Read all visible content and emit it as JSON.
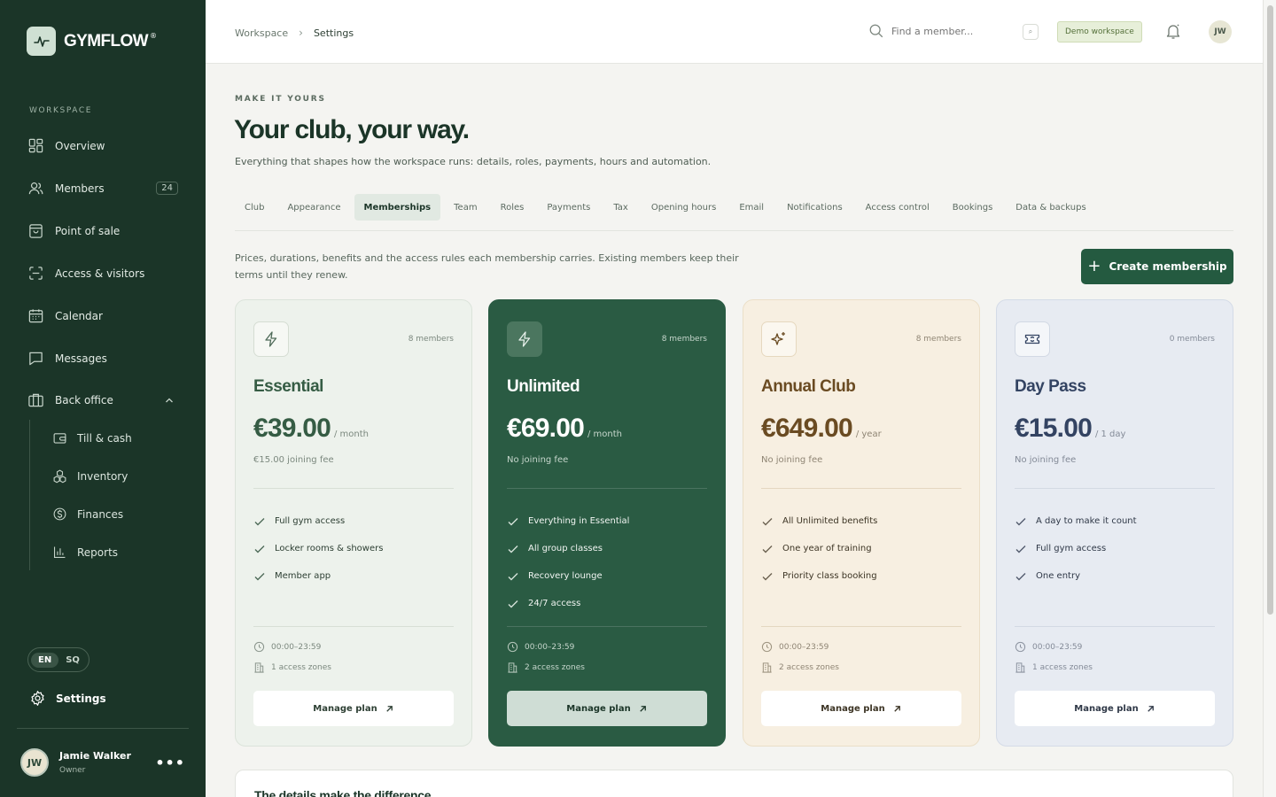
{
  "brand": {
    "name": "GYMFLOW",
    "reg": "®"
  },
  "sidebar": {
    "section_label": "WORKSPACE",
    "items": [
      {
        "label": "Overview",
        "icon": "grid-icon"
      },
      {
        "label": "Members",
        "icon": "users-icon",
        "badge": "24"
      },
      {
        "label": "Point of sale",
        "icon": "bag-icon"
      },
      {
        "label": "Access & visitors",
        "icon": "scan-icon"
      },
      {
        "label": "Calendar",
        "icon": "calendar-icon"
      },
      {
        "label": "Messages",
        "icon": "message-icon"
      },
      {
        "label": "Back office",
        "icon": "briefcase-icon"
      }
    ],
    "sub_items": [
      {
        "label": "Till & cash",
        "icon": "wallet-icon"
      },
      {
        "label": "Inventory",
        "icon": "boxes-icon"
      },
      {
        "label": "Finances",
        "icon": "dollar-icon"
      },
      {
        "label": "Reports",
        "icon": "bar-chart-icon"
      }
    ],
    "languages": [
      "EN",
      "SQ"
    ],
    "settings_label": "Settings",
    "user": {
      "initials": "JW",
      "name": "Jamie Walker",
      "role": "Owner",
      "more": "•••"
    }
  },
  "topbar": {
    "breadcrumb": [
      "Workspace",
      "Settings"
    ],
    "search_placeholder": "Find a member...",
    "kbd": "⌕",
    "demo_badge": "Demo workspace",
    "avatar": "JW"
  },
  "page": {
    "eyebrow": "MAKE IT YOURS",
    "title": "Your club, your way.",
    "lead": "Everything that shapes how the workspace runs: details, roles, payments, hours and automation.",
    "tabs": [
      "Club",
      "Appearance",
      "Memberships",
      "Team",
      "Roles",
      "Payments",
      "Tax",
      "Opening hours",
      "Email",
      "Notifications",
      "Access control",
      "Bookings",
      "Data & backups"
    ],
    "active_tab": "Memberships",
    "description": "Prices, durations, benefits and the access rules each membership carries. Existing members keep their terms until they renew.",
    "create_button": "Create membership",
    "details_title": "The details make the difference"
  },
  "plans": [
    {
      "name": "Essential",
      "members": "8 members",
      "price": "€39.00",
      "period": "/ month",
      "fee": "€15.00 joining fee",
      "features": [
        "Full gym access",
        "Locker rooms & showers",
        "Member app"
      ],
      "hours": "00:00–23:59",
      "zones": "1 access zones",
      "button": "Manage plan",
      "icon": "bolt-icon"
    },
    {
      "name": "Unlimited",
      "members": "8 members",
      "price": "€69.00",
      "period": "/ month",
      "fee": "No joining fee",
      "features": [
        "Everything in Essential",
        "All group classes",
        "Recovery lounge",
        "24/7 access"
      ],
      "hours": "00:00–23:59",
      "zones": "2 access zones",
      "button": "Manage plan",
      "icon": "bolt-icon"
    },
    {
      "name": "Annual Club",
      "members": "8 members",
      "price": "€649.00",
      "period": "/ year",
      "fee": "No joining fee",
      "features": [
        "All Unlimited benefits",
        "One year of training",
        "Priority class booking"
      ],
      "hours": "00:00–23:59",
      "zones": "2 access zones",
      "button": "Manage plan",
      "icon": "sparkles-icon"
    },
    {
      "name": "Day Pass",
      "members": "0 members",
      "price": "€15.00",
      "period": "/ 1 day",
      "fee": "No joining fee",
      "features": [
        "A day to make it count",
        "Full gym access",
        "One entry"
      ],
      "hours": "00:00–23:59",
      "zones": "1 access zones",
      "button": "Manage plan",
      "icon": "ticket-icon"
    }
  ]
}
